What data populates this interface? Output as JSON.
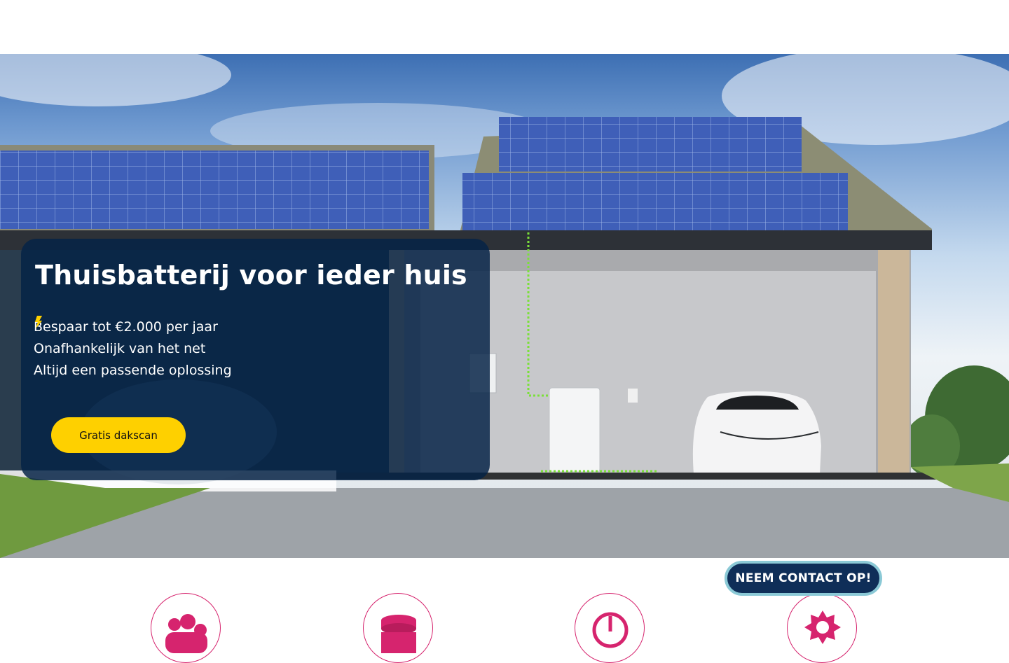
{
  "hero": {
    "title": "Thuisbatterij voor ieder huis",
    "bullets": [
      "Bespaar tot €2.000 per jaar",
      "Onafhankelijk van het net",
      "Altijd een passende oplossing"
    ],
    "bullet_icon": "lightning-bolt-icon",
    "cta_label": "Gratis dakscan",
    "image": "house-with-solar-panels-home-battery-and-electric-car"
  },
  "contact_button": {
    "label": "NEEM CONTACT OP!"
  },
  "features": [
    {
      "icon": "people-gear-icon"
    },
    {
      "icon": "coins-stack-icon"
    },
    {
      "icon": "power-gauge-icon"
    },
    {
      "icon": "sun-gear-icon"
    }
  ],
  "colors": {
    "accent_yellow": "#fed000",
    "card_navy": "#052346",
    "contact_navy": "#0f2e58",
    "contact_border": "#8bc9d6",
    "feature_pink": "#d6246e"
  }
}
